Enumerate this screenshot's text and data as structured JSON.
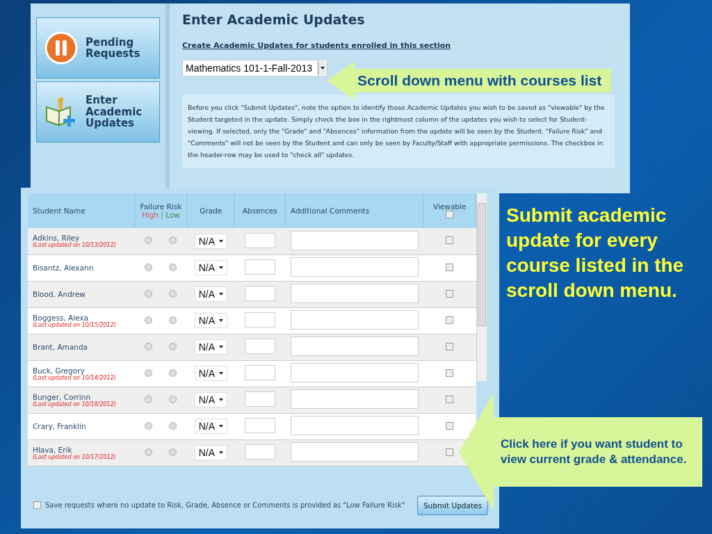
{
  "sidebar": {
    "buttons": [
      {
        "label": "Pending Requests",
        "kind": "pause"
      },
      {
        "label": "Enter Academic Updates",
        "kind": "book"
      }
    ]
  },
  "page": {
    "title": "Enter Academic Updates",
    "link": "Create Academic Updates for students enrolled in this section",
    "course_select": {
      "value": "Mathematics 101-1-Fall-2013"
    },
    "info_text": "Before you click \"Submit Updates\", note the option to identify those Academic Updates you wish to be saved as \"viewable\" by the Student targeted in the update. Simply check the box in the rightmost column of the updates you wish to select for Student-viewing. If selected, only the \"Grade\" and \"Absences\" information from the update will be seen by the Student. \"Failure Risk\" and \"Comments\" will not be seen by the Student and can only be seen by Faculty/Staff with appropriate permissions. The checkbox in the header-row may be used to \"check all\" updates."
  },
  "table": {
    "columns": {
      "student": "Student Name",
      "risk": "Failure Risk",
      "risk_high": "High",
      "risk_sep": "|",
      "risk_low": "Low",
      "grade": "Grade",
      "absences": "Absences",
      "comments": "Additional Comments",
      "viewable": "Viewable"
    },
    "check_all": {
      "checked": false
    },
    "rows": [
      {
        "name": "Adkins, Riley",
        "note": "(Last updated on 10/13/2012)",
        "high": false,
        "low": false,
        "grade": "N/A",
        "viewable": false
      },
      {
        "name": "Bisantz, Alexann",
        "high": false,
        "low": false,
        "grade": "N/A",
        "viewable": false
      },
      {
        "name": "Blood, Andrew",
        "high": false,
        "low": false,
        "grade": "N/A",
        "viewable": false
      },
      {
        "name": "Boggess, Alexa",
        "note": "(Last updated on 10/15/2012)",
        "high": false,
        "low": false,
        "grade": "N/A",
        "viewable": false
      },
      {
        "name": "Brant, Amanda",
        "high": false,
        "low": false,
        "grade": "N/A",
        "viewable": false
      },
      {
        "name": "Buck, Gregory",
        "note": "(Last updated on 10/14/2012)",
        "high": false,
        "low": false,
        "grade": "N/A",
        "viewable": false
      },
      {
        "name": "Bunger, Corrinn",
        "note": "(Last updated on 10/18/2012)",
        "high": false,
        "low": false,
        "grade": "N/A",
        "viewable": false
      },
      {
        "name": "Crary, Franklin",
        "high": false,
        "low": false,
        "grade": "N/A",
        "viewable": false
      },
      {
        "name": "Hlava, Erik",
        "note": "(Last updated on 10/17/2012)",
        "high": false,
        "low": false,
        "grade": "N/A",
        "viewable": false
      }
    ]
  },
  "footer": {
    "save_option": {
      "label": "Save requests where no update to Risk, Grade, Absence or Comments is provided as \"Low Failure Risk\"",
      "checked": false
    },
    "submit": "Submit Updates"
  },
  "callouts": [
    {
      "text": "Scroll down menu with courses list",
      "kind": "top"
    },
    {
      "text": "Click here if you want student to view current grade & attendance.",
      "kind": "bottom"
    }
  ],
  "side_note": "Submit academic update for every course listed in the scroll down menu."
}
